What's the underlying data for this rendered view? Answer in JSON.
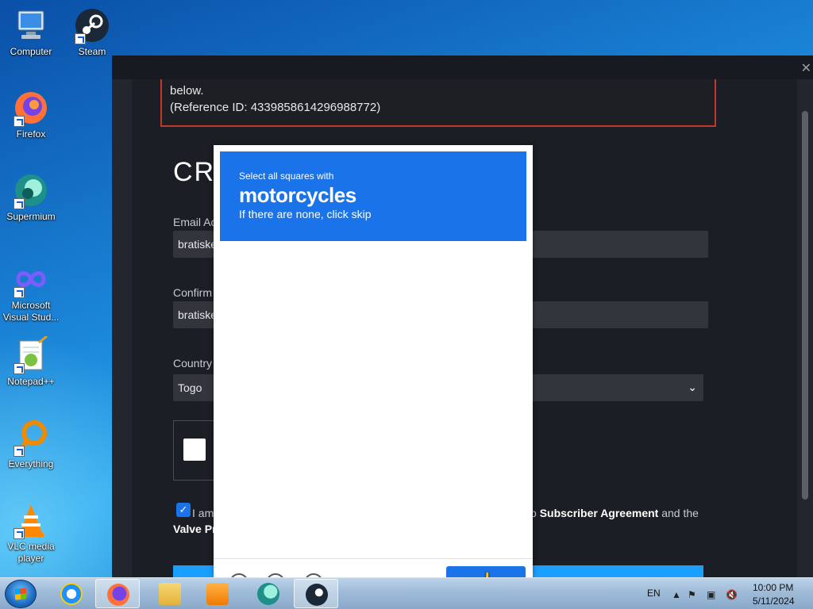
{
  "desktop_icons": [
    {
      "label": "Computer",
      "icon": "computer-icon"
    },
    {
      "label": "Steam",
      "icon": "steam-icon"
    },
    {
      "label": "Firefox",
      "icon": "firefox-icon"
    },
    {
      "label": "Supermium",
      "icon": "supermium-icon"
    },
    {
      "label": "Microsoft Visual Stud...",
      "icon": "visual-studio-icon"
    },
    {
      "label": "Notepad++",
      "icon": "notepad-plus-plus-icon"
    },
    {
      "label": "Everything",
      "icon": "everything-search-icon"
    },
    {
      "label": "VLC media player",
      "icon": "vlc-icon"
    }
  ],
  "steam_page": {
    "error_line1": "below.",
    "error_line2": "(Reference ID: 4339858614296988772)",
    "create_title": "CRE",
    "email_label": "Email Ac",
    "email_value": "bratiske",
    "confirm_label": "Confirm",
    "confirm_value": "bratiske",
    "country_label": "Country",
    "country_value": "Togo",
    "agree_prefix": "I am",
    "agree_link1": "Subscriber Agreement",
    "agree_mid": "and the",
    "agree_link2": "Valve Pr",
    "agree_frag": "o"
  },
  "challenge": {
    "line1": "Select all squares with",
    "target": "motorcycles",
    "line2": "If there are none, click skip"
  },
  "taskbar": {
    "apps": [
      "internet-explorer-icon",
      "firefox-icon",
      "file-explorer-icon",
      "media-player-icon",
      "supermium-icon",
      "steam-icon"
    ],
    "language": "EN",
    "time": "10:00 PM",
    "date": "5/11/2024"
  },
  "colors": {
    "accent": "#1a73e8",
    "error_border": "#c0392b",
    "steam_bg": "#1b1e24"
  }
}
